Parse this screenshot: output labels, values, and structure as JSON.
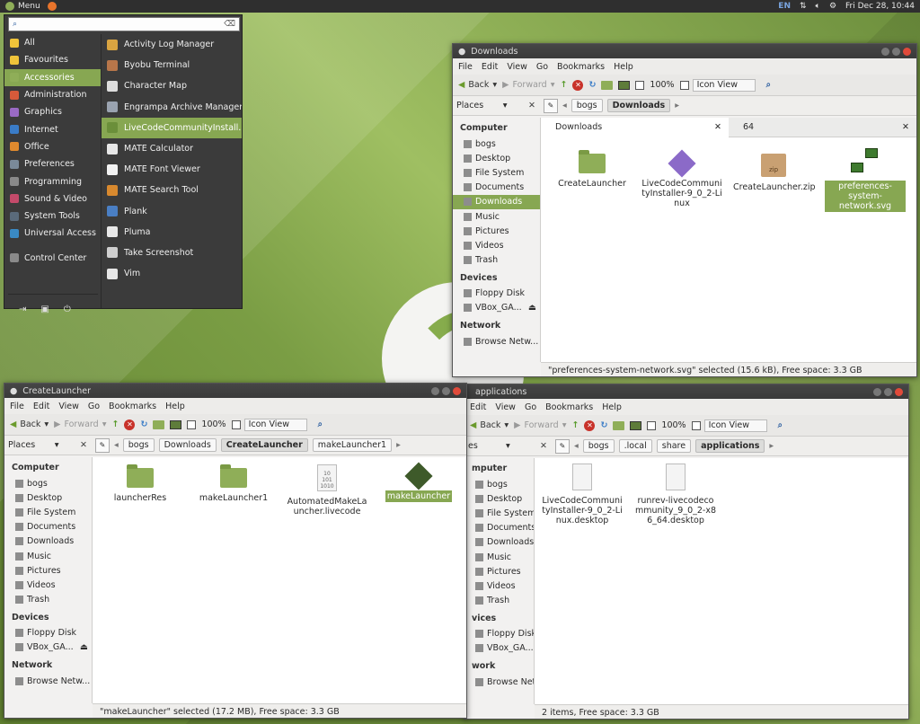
{
  "panel": {
    "menu_label": "Menu",
    "lang": "EN",
    "datetime": "Fri Dec 28, 10:44"
  },
  "app_menu": {
    "categories": [
      {
        "label": "All",
        "icon": "star-icon"
      },
      {
        "label": "Favourites",
        "icon": "star-icon"
      },
      {
        "label": "Accessories",
        "icon": "accessories-icon",
        "selected": true
      },
      {
        "label": "Administration",
        "icon": "administration-icon"
      },
      {
        "label": "Graphics",
        "icon": "graphics-icon"
      },
      {
        "label": "Internet",
        "icon": "internet-icon"
      },
      {
        "label": "Office",
        "icon": "office-icon"
      },
      {
        "label": "Preferences",
        "icon": "preferences-icon"
      },
      {
        "label": "Programming",
        "icon": "programming-icon"
      },
      {
        "label": "Sound & Video",
        "icon": "sound-video-icon"
      },
      {
        "label": "System Tools",
        "icon": "system-tools-icon"
      },
      {
        "label": "Universal Access",
        "icon": "universal-access-icon"
      },
      {
        "label": "Control Center",
        "icon": "control-center-icon"
      }
    ],
    "apps": [
      {
        "label": "Activity Log Manager",
        "color": "#d9a441"
      },
      {
        "label": "Byobu Terminal",
        "color": "#b8764a"
      },
      {
        "label": "Character Map",
        "color": "#dddddd"
      },
      {
        "label": "Engrampa Archive Manager",
        "color": "#9aa3b0"
      },
      {
        "label": "LiveCodeCommunityInstall...",
        "color": "#6b8f3a",
        "selected": true
      },
      {
        "label": "MATE Calculator",
        "color": "#e7e7e7"
      },
      {
        "label": "MATE Font Viewer",
        "color": "#f2f2f2"
      },
      {
        "label": "MATE Search Tool",
        "color": "#d8892e"
      },
      {
        "label": "Plank",
        "color": "#4a7fc4"
      },
      {
        "label": "Pluma",
        "color": "#e8e8e8"
      },
      {
        "label": "Take Screenshot",
        "color": "#cfcfcf"
      },
      {
        "label": "Vim",
        "color": "#e6e6e6"
      }
    ]
  },
  "win_downloads": {
    "title": "Downloads",
    "menus": [
      "File",
      "Edit",
      "View",
      "Go",
      "Bookmarks",
      "Help"
    ],
    "back": "Back",
    "forward": "Forward",
    "zoom": "100%",
    "view_mode": "Icon View",
    "places": "Places",
    "crumbs": [
      "bogs",
      "Downloads"
    ],
    "tabs": [
      "Downloads",
      "64"
    ],
    "sidebar": {
      "computer": "Computer",
      "computer_items": [
        "bogs",
        "Desktop",
        "File System",
        "Documents",
        "Downloads",
        "Music",
        "Pictures",
        "Videos",
        "Trash"
      ],
      "devices": "Devices",
      "device_items": [
        "Floppy Disk",
        "VBox_GA..."
      ],
      "network": "Network",
      "network_items": [
        "Browse Netw..."
      ]
    },
    "files": [
      {
        "name": "CreateLauncher",
        "kind": "folder"
      },
      {
        "name": "LiveCodeCommunityInstaller-9_0_2-Linux",
        "kind": "installer"
      },
      {
        "name": "CreateLauncher.zip",
        "kind": "zip"
      },
      {
        "name": "preferences-system-network.svg",
        "kind": "network"
      }
    ],
    "zip_badge": "zip",
    "status": "\"preferences-system-network.svg\" selected (15.6 kB), Free space: 3.3 GB"
  },
  "win_createlauncher": {
    "title": "CreateLauncher",
    "menus": [
      "File",
      "Edit",
      "View",
      "Go",
      "Bookmarks",
      "Help"
    ],
    "back": "Back",
    "forward": "Forward",
    "zoom": "100%",
    "view_mode": "Icon View",
    "places": "Places",
    "crumbs": [
      "bogs",
      "Downloads",
      "CreateLauncher",
      "makeLauncher1"
    ],
    "sidebar": {
      "computer": "Computer",
      "computer_items": [
        "bogs",
        "Desktop",
        "File System",
        "Documents",
        "Downloads",
        "Music",
        "Pictures",
        "Videos",
        "Trash"
      ],
      "devices": "Devices",
      "device_items": [
        "Floppy Disk",
        "VBox_GA..."
      ],
      "network": "Network",
      "network_items": [
        "Browse Netw..."
      ]
    },
    "files": [
      {
        "name": "launcherRes",
        "kind": "folder"
      },
      {
        "name": "makeLauncher1",
        "kind": "folder"
      },
      {
        "name": "AutomatedMakeLauncher.livecode",
        "kind": "doc"
      },
      {
        "name": "makeLauncher",
        "kind": "exec"
      }
    ],
    "doc_glyph_lines": [
      "10",
      "101",
      "1010"
    ],
    "status": "\"makeLauncher\" selected (17.2 MB), Free space: 3.3 GB"
  },
  "win_applications": {
    "title": "applications",
    "menus": [
      "Edit",
      "View",
      "Go",
      "Bookmarks",
      "Help"
    ],
    "back": "Back",
    "forward": "Forward",
    "zoom": "100%",
    "view_mode": "Icon View",
    "places": "es",
    "crumbs": [
      "bogs",
      ".local",
      "share",
      "applications"
    ],
    "sidebar": {
      "computer": "mputer",
      "computer_items": [
        "bogs",
        "Desktop",
        "File System",
        "Documents",
        "Downloads",
        "Music",
        "Pictures",
        "Videos",
        "Trash"
      ],
      "devices": "vices",
      "device_items": [
        "Floppy Disk",
        "VBox_GA..."
      ],
      "network": "work",
      "network_items": [
        "Browse Netw..."
      ]
    },
    "files": [
      {
        "name": "LiveCodeCommunityInstaller-9_0_2-Linux.desktop",
        "kind": "doc"
      },
      {
        "name": "runrev-livecodecommunity_9_0_2-x86_64.desktop",
        "kind": "doc"
      }
    ],
    "status": "2 items, Free space: 3.3 GB"
  }
}
